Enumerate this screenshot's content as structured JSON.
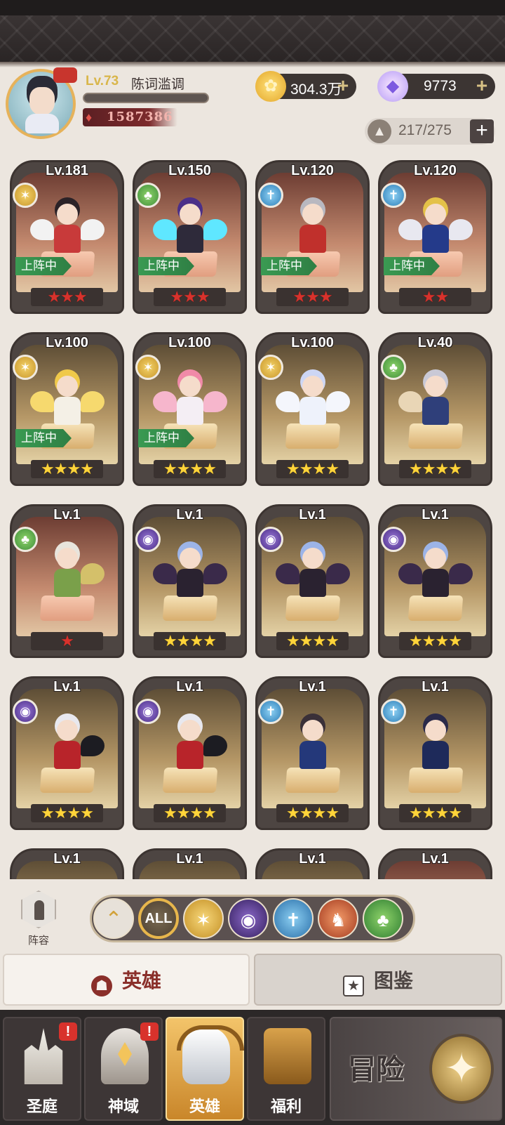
{
  "player": {
    "level": "Lv.73",
    "name": "陈词滥调",
    "power": "1587386"
  },
  "resources": {
    "gold": "304.3万",
    "diamond": "9773",
    "hero_capacity": "217/275"
  },
  "deploy_label": "上阵中",
  "heroes": [
    {
      "level": "Lv.181",
      "stars": "★★★"
    },
    {
      "level": "Lv.150",
      "stars": "★★★"
    },
    {
      "level": "Lv.120",
      "stars": "★★★"
    },
    {
      "level": "Lv.120",
      "stars": "★★"
    },
    {
      "level": "Lv.100",
      "stars": "★★★★"
    },
    {
      "level": "Lv.100",
      "stars": "★★★★"
    },
    {
      "level": "Lv.100",
      "stars": "★★★★"
    },
    {
      "level": "Lv.40",
      "stars": "★★★★"
    },
    {
      "level": "Lv.1",
      "stars": "★"
    },
    {
      "level": "Lv.1",
      "stars": "★★★★"
    },
    {
      "level": "Lv.1",
      "stars": "★★★★"
    },
    {
      "level": "Lv.1",
      "stars": "★★★★"
    },
    {
      "level": "Lv.1",
      "stars": "★★★★"
    },
    {
      "level": "Lv.1",
      "stars": "★★★★"
    },
    {
      "level": "Lv.1",
      "stars": "★★★★"
    },
    {
      "level": "Lv.1",
      "stars": "★★★★"
    },
    {
      "level": "Lv.1",
      "stars": ""
    },
    {
      "level": "Lv.1",
      "stars": ""
    },
    {
      "level": "Lv.1",
      "stars": ""
    },
    {
      "level": "Lv.1",
      "stars": ""
    }
  ],
  "filter": {
    "lineup_label": "阵容",
    "all_label": "ALL"
  },
  "tabs": {
    "heroes": "英雄",
    "codex": "图鉴"
  },
  "nav": {
    "courtyard": "圣庭",
    "divine": "神域",
    "heroes": "英雄",
    "welfare": "福利",
    "adventure": "冒险",
    "badge": "!"
  }
}
